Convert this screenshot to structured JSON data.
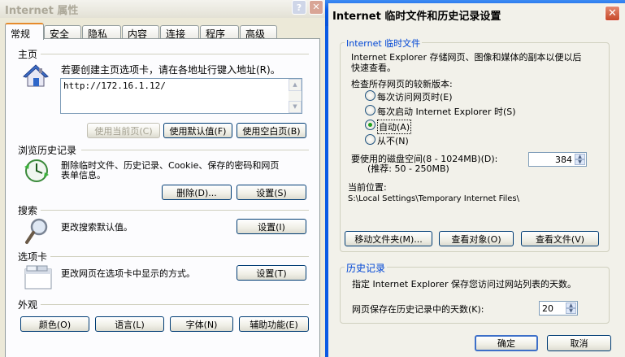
{
  "left_window": {
    "title": "Internet 属性",
    "tabs": [
      "常规",
      "安全",
      "隐私",
      "内容",
      "连接",
      "程序",
      "高级"
    ],
    "home": {
      "heading": "主页",
      "desc": "若要创建主页选项卡，请在各地址行键入地址(R)。",
      "address": "http://172.16.1.12/",
      "btn_current": "使用当前页(C)",
      "btn_default": "使用默认值(F)",
      "btn_blank": "使用空白页(B)"
    },
    "history": {
      "heading": "浏览历史记录",
      "desc_line1": "删除临时文件、历史记录、Cookie、保存的密码和网页",
      "desc_line2": "表单信息。",
      "btn_delete": "删除(D)...",
      "btn_settings": "设置(S)"
    },
    "search": {
      "heading": "搜索",
      "desc": "更改搜索默认值。",
      "btn_settings": "设置(I)"
    },
    "tabs_section": {
      "heading": "选项卡",
      "desc": "更改网页在选项卡中显示的方式。",
      "btn_settings": "设置(T)"
    },
    "appearance": {
      "heading": "外观",
      "btn_colors": "颜色(O)",
      "btn_languages": "语言(L)",
      "btn_fonts": "字体(N)",
      "btn_accessibility": "辅助功能(E)"
    }
  },
  "right_window": {
    "title": "Internet 临时文件和历史记录设置",
    "temp_files": {
      "legend": "Internet 临时文件",
      "desc_line1": "Internet Explorer 存储网页、图像和媒体的副本以便以后",
      "desc_line2": "快速查看。",
      "check_label": "检查所存网页的较新版本:",
      "radio_options": [
        {
          "label": "每次访问网页时(E)",
          "checked": false
        },
        {
          "label": "每次启动 Internet Explorer 时(S)",
          "checked": false
        },
        {
          "label": "自动(A)",
          "checked": true
        },
        {
          "label": "从不(N)",
          "checked": false
        }
      ],
      "disk_label_line1": "要使用的磁盘空间(8 - 1024MB)(D):",
      "disk_label_line2": "(推荐: 50 - 250MB)",
      "disk_value": "384",
      "location_label": "当前位置:",
      "location_path": "S:\\Local Settings\\Temporary Internet Files\\",
      "btn_move": "移动文件夹(M)...",
      "btn_view_objects": "查看对象(O)",
      "btn_view_files": "查看文件(V)"
    },
    "history": {
      "legend": "历史记录",
      "desc": "指定 Internet Explorer 保存您访问过网站列表的天数。",
      "days_label": "网页保存在历史记录中的天数(K):",
      "days_value": "20"
    },
    "btn_ok": "确定",
    "btn_cancel": "取消"
  }
}
